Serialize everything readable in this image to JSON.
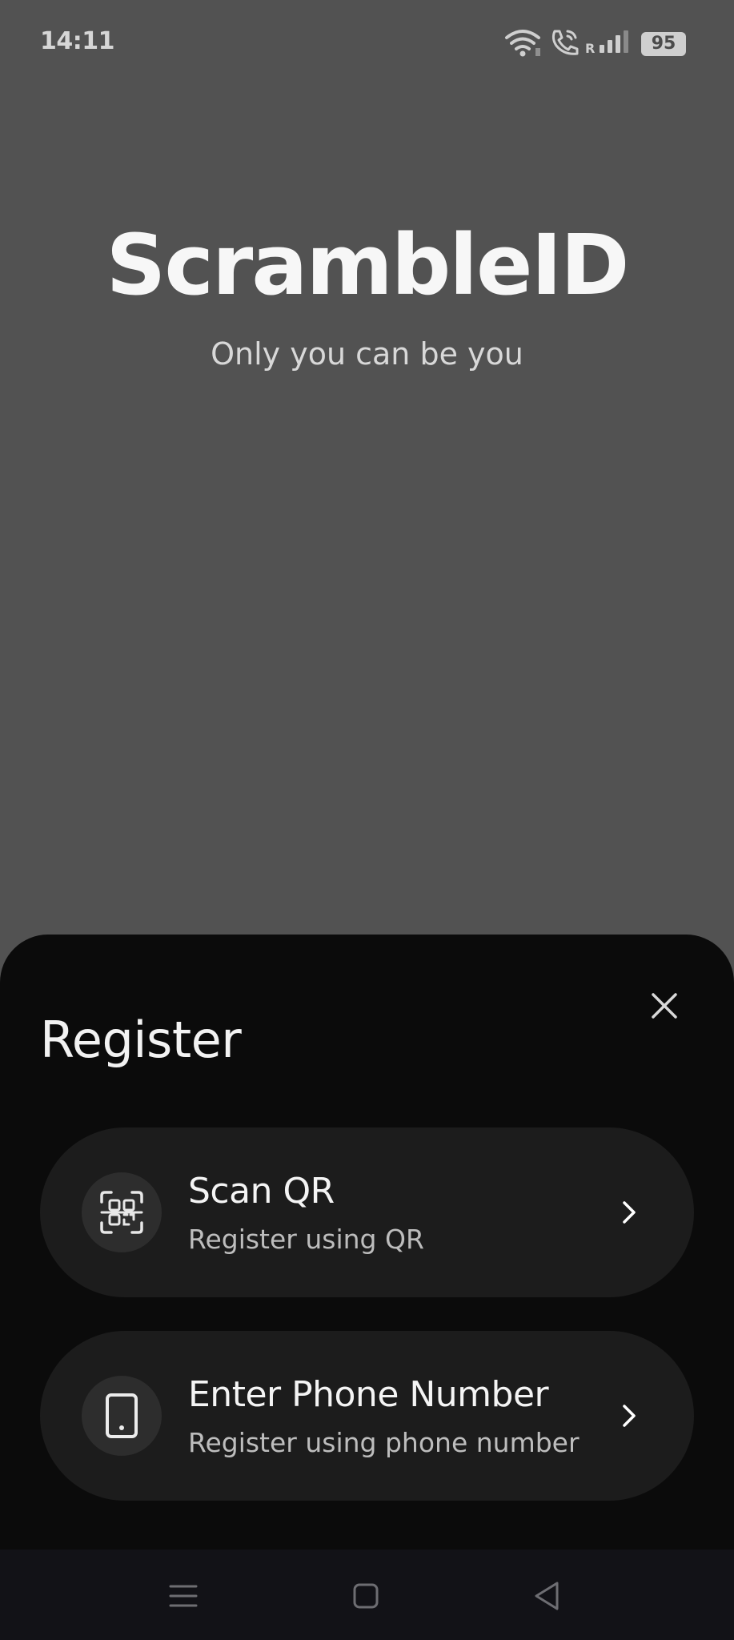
{
  "status_bar": {
    "time": "14:11",
    "roaming": "R",
    "battery": "95",
    "icons": [
      "wifi-icon",
      "call-icon",
      "signal-icon",
      "battery-icon"
    ]
  },
  "hero": {
    "title": "ScrambleID",
    "tagline": "Only you can be you"
  },
  "sheet": {
    "title": "Register",
    "options": [
      {
        "title": "Scan QR",
        "subtitle": "Register using QR",
        "icon": "qr-scan-icon"
      },
      {
        "title": "Enter Phone Number",
        "subtitle": "Register using phone number",
        "icon": "phone-icon"
      }
    ]
  },
  "colors": {
    "background": "#525252",
    "sheet": "#0b0b0b",
    "card": "#1c1c1c",
    "icon_circle": "#2d2d2d",
    "nav_bar": "#121217"
  }
}
